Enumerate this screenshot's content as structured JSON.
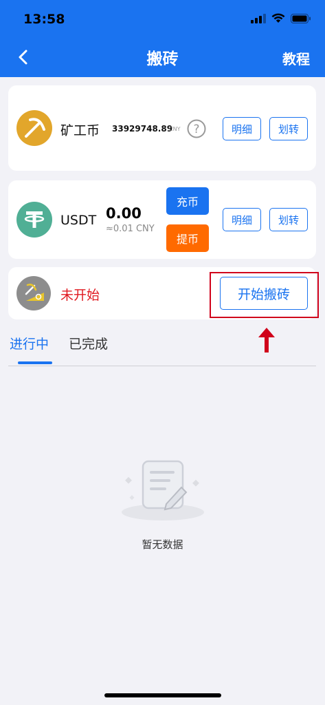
{
  "status_bar": {
    "time": "13:58"
  },
  "nav": {
    "title": "搬砖",
    "right_action": "教程",
    "back_icon": "chevron-left-icon"
  },
  "mine_card": {
    "coin_name": "矿工币",
    "amount": "33929748.89",
    "unit": "CNY",
    "detail_label": "明细",
    "transfer_label": "划转",
    "icon": "pickaxe-icon"
  },
  "usdt_card": {
    "coin_name": "USDT",
    "amount": "0.00",
    "approx": "≈0.01 CNY",
    "deposit_label": "充币",
    "withdraw_label": "提币",
    "detail_label": "明细",
    "transfer_label": "划转",
    "icon": "tether-icon"
  },
  "status_card": {
    "status_text": "未开始",
    "start_label": "开始搬砖",
    "icon": "mining-status-icon"
  },
  "tabs": [
    {
      "label": "进行中",
      "active": true
    },
    {
      "label": "已完成",
      "active": false
    }
  ],
  "empty": {
    "text": "暂无数据",
    "icon": "empty-document-icon"
  },
  "colors": {
    "primary": "#1a73f0",
    "withdraw": "#ff6a00",
    "status_red": "#e0181f",
    "highlight_red": "#d0021b",
    "tether_green": "#50af95",
    "gold": "#e2a62b"
  }
}
